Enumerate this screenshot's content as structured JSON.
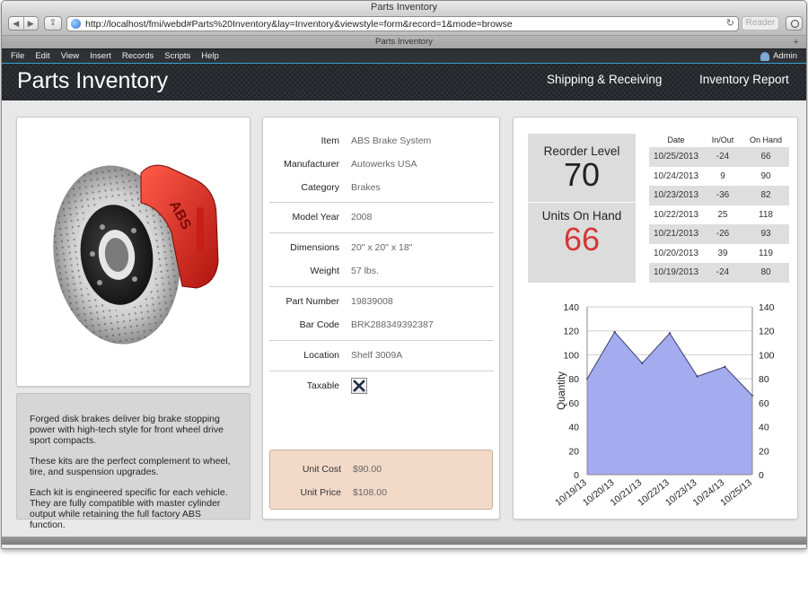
{
  "window": {
    "title": "Parts Inventory",
    "url": "http://localhost/fmi/webd#Parts%20Inventory&lay=Inventory&viewstyle=form&record=1&mode=browse",
    "reader_label": "Reader",
    "tab_title": "Parts Inventory"
  },
  "menu": {
    "items": [
      "File",
      "Edit",
      "View",
      "Insert",
      "Records",
      "Scripts",
      "Help"
    ],
    "user": "Admin"
  },
  "header": {
    "title": "Parts Inventory",
    "nav": [
      "Shipping & Receiving",
      "Inventory Report"
    ]
  },
  "description": [
    "Forged disk brakes deliver big brake stopping power with high-tech style for front wheel drive sport compacts.",
    "These kits are the perfect complement to wheel, tire, and suspension upgrades.",
    "Each kit is engineered specific for each vehicle. They are fully compatible with master cylinder output while retaining the full factory ABS function."
  ],
  "fields": [
    {
      "label": "Item",
      "value": "ABS Brake System"
    },
    {
      "label": "Manufacturer",
      "value": "Autowerks USA"
    },
    {
      "label": "Category",
      "value": "Brakes"
    },
    {
      "label": "Model Year",
      "value": "2008"
    },
    {
      "label": "Dimensions",
      "value": "20\" x 20\" x 18\""
    },
    {
      "label": "Weight",
      "value": "57 lbs."
    },
    {
      "label": "Part Number",
      "value": "19839008"
    },
    {
      "label": "Bar Code",
      "value": "BRK288349392387"
    },
    {
      "label": "Location",
      "value": "Shelf 3009A"
    },
    {
      "label": "Taxable",
      "value": ""
    }
  ],
  "taxable": true,
  "pricing": {
    "unit_cost_label": "Unit Cost",
    "unit_cost": "$90.00",
    "unit_price_label": "Unit Price",
    "unit_price": "$108.00"
  },
  "kpis": {
    "reorder_label": "Reorder Level",
    "reorder_value": "70",
    "onhand_label": "Units On Hand",
    "onhand_value": "66",
    "onhand_color": "#d63636"
  },
  "inventory_table": {
    "columns": [
      "Date",
      "In/Out",
      "On Hand"
    ],
    "rows": [
      [
        "10/25/2013",
        "-24",
        "66"
      ],
      [
        "10/24/2013",
        "9",
        "90"
      ],
      [
        "10/23/2013",
        "-36",
        "82"
      ],
      [
        "10/22/2013",
        "25",
        "118"
      ],
      [
        "10/21/2013",
        "-26",
        "93"
      ],
      [
        "10/20/2013",
        "39",
        "119"
      ],
      [
        "10/19/2013",
        "-24",
        "80"
      ]
    ]
  },
  "chart_data": {
    "type": "area",
    "x": [
      "10/19/13",
      "10/20/13",
      "10/21/13",
      "10/22/13",
      "10/23/13",
      "10/24/13",
      "10/25/13"
    ],
    "series": [
      {
        "values": [
          80,
          119,
          93,
          118,
          82,
          90,
          66
        ]
      }
    ],
    "ylabel": "Quantity",
    "xlabel": "",
    "ylim": [
      0,
      140
    ],
    "yticks": [
      0,
      20,
      40,
      60,
      80,
      100,
      120,
      140
    ],
    "fill_color": "#a4abee",
    "line_color": "#3a3f6e",
    "grid": true
  }
}
